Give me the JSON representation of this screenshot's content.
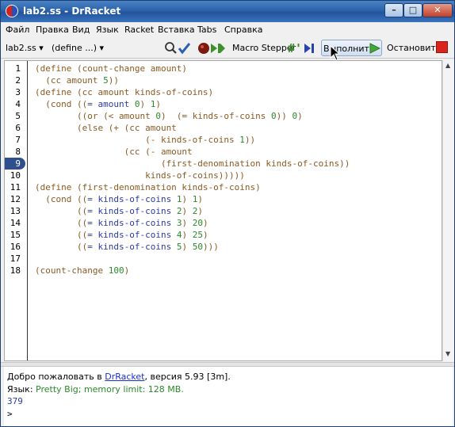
{
  "window": {
    "title": "lab2.ss - DrRacket",
    "controls": {
      "minimize": "–",
      "maximize": "□",
      "close": "✕"
    }
  },
  "menu": [
    "Файл",
    "Правка",
    "Вид",
    "Язык",
    "Racket",
    "Вставка",
    "Tabs",
    "Справка"
  ],
  "toolbar": {
    "file_dropdown": "lab2.ss",
    "define_dropdown": "(define ...)",
    "macro_stepper": "Macro Stepper",
    "run": "Выполнить",
    "stop": "Остановить"
  },
  "editor": {
    "lines": [
      {
        "n": "1",
        "tokens": [
          [
            "p",
            "(define (count-change amount)"
          ]
        ]
      },
      {
        "n": "2",
        "tokens": [
          [
            "p",
            "  (cc amount "
          ],
          [
            "c",
            "5"
          ],
          [
            "p",
            "))"
          ]
        ]
      },
      {
        "n": "3",
        "tokens": [
          [
            "p",
            "(define (cc amount kinds-of-coins)"
          ]
        ]
      },
      {
        "n": "4",
        "tokens": [
          [
            "p",
            "  (cond (("
          ],
          [
            "s",
            "= amount "
          ],
          [
            "c",
            "0"
          ],
          [
            "p",
            ") "
          ],
          [
            "c",
            "1"
          ],
          [
            "p",
            ")"
          ]
        ]
      },
      {
        "n": "5",
        "tokens": [
          [
            "p",
            "        ((or (< amount "
          ],
          [
            "c",
            "0"
          ],
          [
            "p",
            ")  (= kinds-of-coins "
          ],
          [
            "c",
            "0"
          ],
          [
            "p",
            ")) "
          ],
          [
            "c",
            "0"
          ],
          [
            "p",
            ")"
          ]
        ]
      },
      {
        "n": "6",
        "tokens": [
          [
            "p",
            "        (else (+ (cc amount"
          ]
        ]
      },
      {
        "n": "7",
        "tokens": [
          [
            "p",
            "                     (- kinds-of-coins "
          ],
          [
            "c",
            "1"
          ],
          [
            "p",
            "))"
          ]
        ]
      },
      {
        "n": "8",
        "tokens": [
          [
            "p",
            "                 (cc (- amount"
          ]
        ]
      },
      {
        "n": "9",
        "tokens": [
          [
            "p",
            "                        (first-denomination kinds-of-coins))"
          ]
        ]
      },
      {
        "n": "10",
        "tokens": [
          [
            "p",
            "                     kinds-of-coins)))))"
          ]
        ]
      },
      {
        "n": "11",
        "tokens": [
          [
            "p",
            "(define (first-denomination kinds-of-coins)"
          ]
        ]
      },
      {
        "n": "12",
        "tokens": [
          [
            "p",
            "  (cond (("
          ],
          [
            "s",
            "= kinds-of-coins "
          ],
          [
            "c",
            "1"
          ],
          [
            "p",
            ") "
          ],
          [
            "c",
            "1"
          ],
          [
            "p",
            ")"
          ]
        ]
      },
      {
        "n": "13",
        "tokens": [
          [
            "p",
            "        (("
          ],
          [
            "s",
            "= kinds-of-coins "
          ],
          [
            "c",
            "2"
          ],
          [
            "p",
            ") "
          ],
          [
            "c",
            "2"
          ],
          [
            "p",
            ")"
          ]
        ]
      },
      {
        "n": "14",
        "tokens": [
          [
            "p",
            "        (("
          ],
          [
            "s",
            "= kinds-of-coins "
          ],
          [
            "c",
            "3"
          ],
          [
            "p",
            ") "
          ],
          [
            "c",
            "20"
          ],
          [
            "p",
            ")"
          ]
        ]
      },
      {
        "n": "15",
        "tokens": [
          [
            "p",
            "        (("
          ],
          [
            "s",
            "= kinds-of-coins "
          ],
          [
            "c",
            "4"
          ],
          [
            "p",
            ") "
          ],
          [
            "c",
            "25"
          ],
          [
            "p",
            ")"
          ]
        ]
      },
      {
        "n": "16",
        "tokens": [
          [
            "p",
            "        (("
          ],
          [
            "s",
            "= kinds-of-coins "
          ],
          [
            "c",
            "5"
          ],
          [
            "p",
            ") "
          ],
          [
            "c",
            "50"
          ],
          [
            "p",
            ")))"
          ]
        ]
      },
      {
        "n": "17",
        "tokens": []
      },
      {
        "n": "18",
        "tokens": [
          [
            "p",
            "(count-change "
          ],
          [
            "c",
            "100"
          ],
          [
            "p",
            ")"
          ]
        ]
      }
    ],
    "breakpoint_line": "9"
  },
  "repl": {
    "welcome_prefix": "Добро пожаловать в ",
    "welcome_link": "DrRacket",
    "welcome_suffix": ", версия 5.93 [3m].",
    "lang_prefix": "Язык: ",
    "lang_value": "Pretty Big; memory limit: 128 MB.",
    "result": "379",
    "prompt": ">"
  },
  "colors": {
    "paren": "#8a5a22",
    "symbol": "#2b3ca8",
    "constant": "#2a8a2a",
    "titlebar": "#2d62ab"
  }
}
